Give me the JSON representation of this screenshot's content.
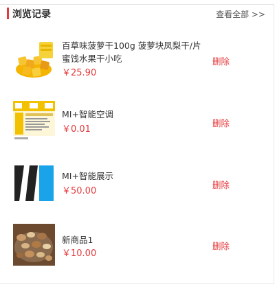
{
  "header": {
    "title": "浏览记录",
    "view_all": "查看全部 >>"
  },
  "items": [
    {
      "name": "百草味菠萝干100g 菠萝块凤梨干/片蜜饯水果干小吃",
      "price": "￥25.90",
      "delete": "删除",
      "icon": "dried-pineapple-image"
    },
    {
      "name": "MI+智能空调",
      "price": "￥0.01",
      "delete": "删除",
      "icon": "product-label-image"
    },
    {
      "name": "MI+智能展示",
      "price": "￥50.00",
      "delete": "删除",
      "icon": "mi-logo-image"
    },
    {
      "name": "新商品1",
      "price": "￥10.00",
      "delete": "删除",
      "icon": "mixed-nuts-image"
    }
  ],
  "colors": {
    "accent": "#e4393c",
    "text": "#333333",
    "border": "#e6e6e6"
  }
}
